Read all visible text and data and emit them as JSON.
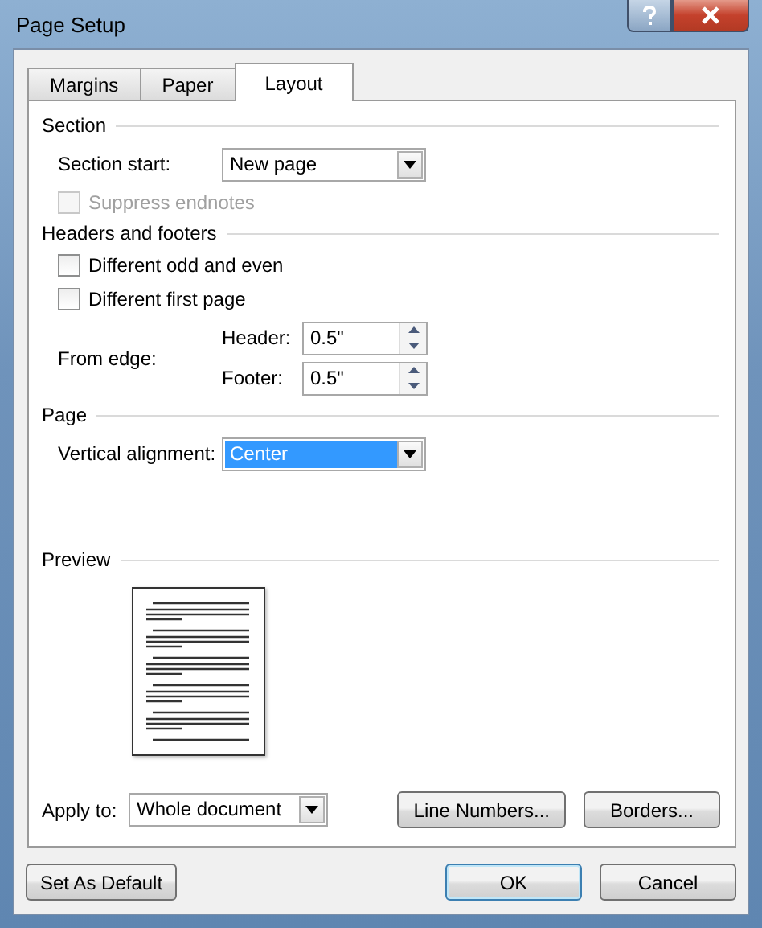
{
  "window": {
    "title": "Page Setup"
  },
  "tabs": [
    {
      "label": "Margins",
      "selected": false
    },
    {
      "label": "Paper",
      "selected": false
    },
    {
      "label": "Layout",
      "selected": true
    }
  ],
  "section": {
    "title": "Section",
    "section_start": {
      "label": "Section start:",
      "value": "New page"
    },
    "suppress_endnotes": {
      "label": "Suppress endnotes",
      "checked": false,
      "disabled": true
    }
  },
  "headers_and_footers": {
    "title": "Headers and footers",
    "checkboxes": [
      {
        "label": "Different odd and even",
        "checked": false
      },
      {
        "label": "Different first page",
        "checked": false
      }
    ],
    "from_edge": {
      "label": "From edge:",
      "fields": [
        {
          "label": "Header:",
          "value": "0.5\""
        },
        {
          "label": "Footer:",
          "value": "0.5\""
        }
      ]
    }
  },
  "page": {
    "title": "Page",
    "vertical_alignment": {
      "label": "Vertical alignment:",
      "value": "Center",
      "focused": true
    }
  },
  "preview": {
    "title": "Preview"
  },
  "apply_to": {
    "label": "Apply to:",
    "value": "Whole document"
  },
  "panel_buttons": [
    {
      "label": "Line Numbers..."
    },
    {
      "label": "Borders..."
    }
  ],
  "footer_buttons": [
    {
      "label": "Set As Default",
      "default": false
    },
    {
      "label": "OK",
      "default": true
    },
    {
      "label": "Cancel",
      "default": false
    }
  ]
}
